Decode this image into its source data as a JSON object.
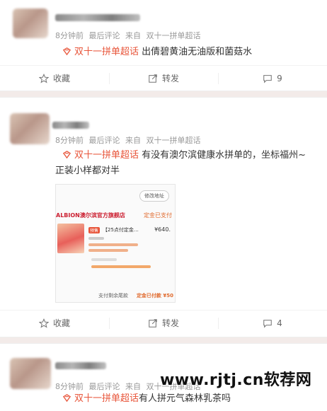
{
  "posts": [
    {
      "time": "8分钟前",
      "last_comment": "最后评论",
      "from_label": "来自",
      "source": "双十一拼单超话",
      "topic": "双十一拼单超话",
      "text": "出倩碧黄油无油版和菌菇水",
      "actions": {
        "collect": "收藏",
        "repost": "转发",
        "comment_count": "9"
      }
    },
    {
      "time": "8分钟前",
      "last_comment": "最后评论",
      "from_label": "来自",
      "source": "双十一拼单超话",
      "topic": "双十一拼单超话",
      "text_line1": "有没有澳尔滨健康水拼单的，坐标福州~",
      "text_line2": "正装小样都对半",
      "screenshot": {
        "button": "修改地址",
        "store": "ALBION澳尔滨官方旗舰店",
        "store_status": "定金已支付",
        "tag": "预售",
        "product": "【25点付定金…",
        "price": "¥640.",
        "footer_left": "支付剩余尾款",
        "footer_right": "定金已付款 ¥50"
      },
      "actions": {
        "collect": "收藏",
        "repost": "转发",
        "comment_count": "4"
      }
    },
    {
      "time": "8分钟前",
      "last_comment": "最后评论",
      "from_label": "来自",
      "source": "双十一拼单超话",
      "topic": "双十一拼单超话",
      "text": "有人拼元气森林乳茶吗"
    }
  ],
  "watermark": "www.rjtj.cn软荐网",
  "colors": {
    "topic": "#e8553a",
    "divider": "#f3ebe9",
    "meta": "#999999"
  },
  "icons": [
    "star-icon",
    "repost-icon",
    "comment-icon",
    "super-topic-icon"
  ]
}
